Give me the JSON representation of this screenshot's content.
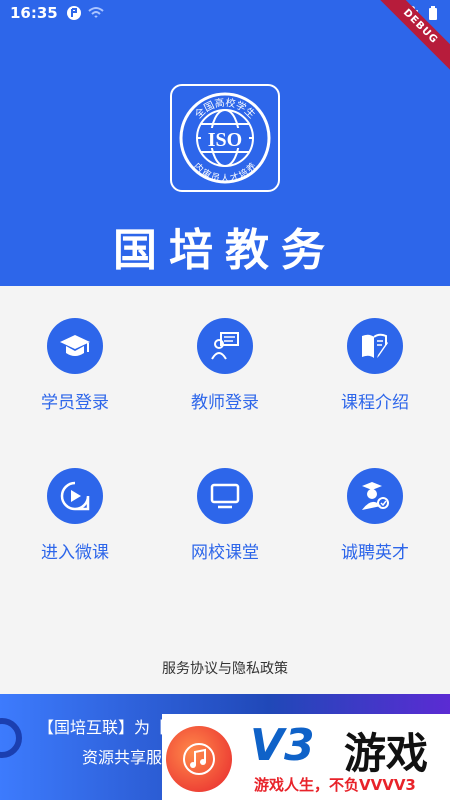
{
  "status_bar": {
    "time": "16:35"
  },
  "debug_ribbon": "DEBUG",
  "header": {
    "logo": {
      "ring_top_text": "全国高校学生",
      "center_text": "ISO",
      "ring_bottom_text": "内审员人才培养"
    },
    "title": "国培教务"
  },
  "grid": [
    {
      "label": "学员登录",
      "icon": "graduation-cap-icon"
    },
    {
      "label": "教师登录",
      "icon": "teacher-board-icon"
    },
    {
      "label": "课程介绍",
      "icon": "book-pen-icon"
    },
    {
      "label": "进入微课",
      "icon": "play-icon"
    },
    {
      "label": "网校课堂",
      "icon": "monitor-icon"
    },
    {
      "label": "诚聘英才",
      "icon": "graduate-user-icon"
    }
  ],
  "footer": {
    "policy_link": "服务协议与隐私政策"
  },
  "banner": {
    "line1": "【国培互联】为【",
    "line2": "资源共享服"
  },
  "ad": {
    "brand": "V3",
    "word": "游戏",
    "slogan": "游戏人生，不负VVVV3"
  },
  "colors": {
    "primary": "#2d66ea",
    "background": "#f4f4f4"
  }
}
